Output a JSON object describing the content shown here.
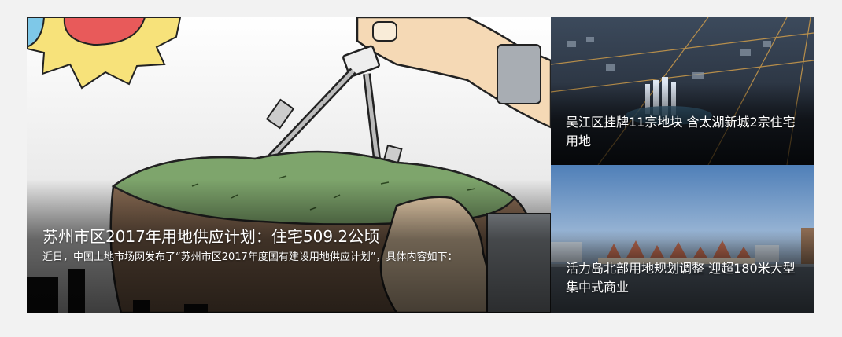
{
  "featured": {
    "title": "苏州市区2017年用地供应计划：住宅509.2公顷",
    "summary": "近日，中国土地市场网发布了“苏州市区2017年度国有建设用地供应计划”，具体内容如下："
  },
  "side_stories": [
    {
      "title": "吴江区挂牌11宗地块 含太湖新城2宗住宅用地"
    },
    {
      "title": "活力岛北部用地规划调整 迎超180米大型集中式商业"
    }
  ]
}
